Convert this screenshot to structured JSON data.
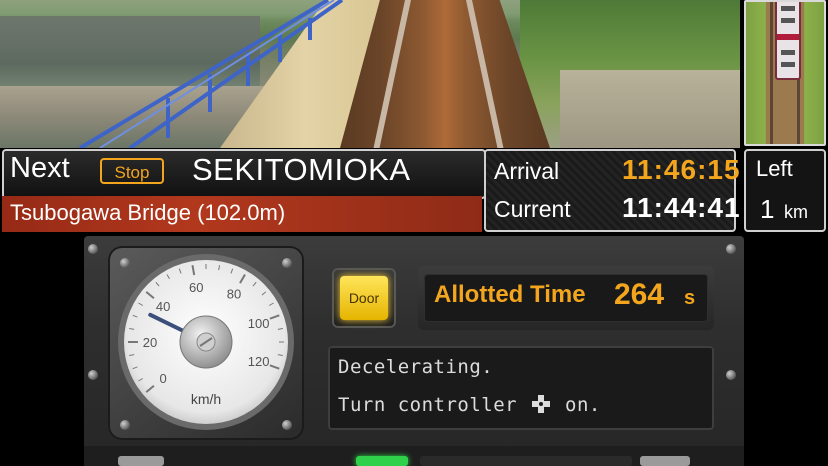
{
  "top_hud": {
    "next_label": "Next",
    "stop_badge": "Stop",
    "station_name": "SEKITOMIOKA",
    "location": "Tsubogawa Bridge (102.0m)",
    "arrival_label": "Arrival",
    "arrival_time": "11:46:15",
    "current_label": "Current",
    "current_time": "11:44:41",
    "left_label": "Left",
    "left_value": "1",
    "left_unit": "km"
  },
  "speedometer": {
    "unit_label": "km/h",
    "tick_labels": [
      "0",
      "20",
      "40",
      "60",
      "80",
      "100",
      "120"
    ],
    "max_speed": 120,
    "speed_value": 33
  },
  "controls": {
    "door_button_label": "Door",
    "allotted_time_label": "Allotted Time",
    "allotted_time_value": "264",
    "allotted_time_unit": "s"
  },
  "message": {
    "line1": "Decelerating.",
    "line2_prefix": "Turn controller",
    "line2_icon": "dpad-icon",
    "line2_suffix": "on."
  },
  "colors": {
    "accent_orange": "#f3a51e",
    "location_bar": "#b2381d",
    "door_lit": "#ffd43a"
  }
}
